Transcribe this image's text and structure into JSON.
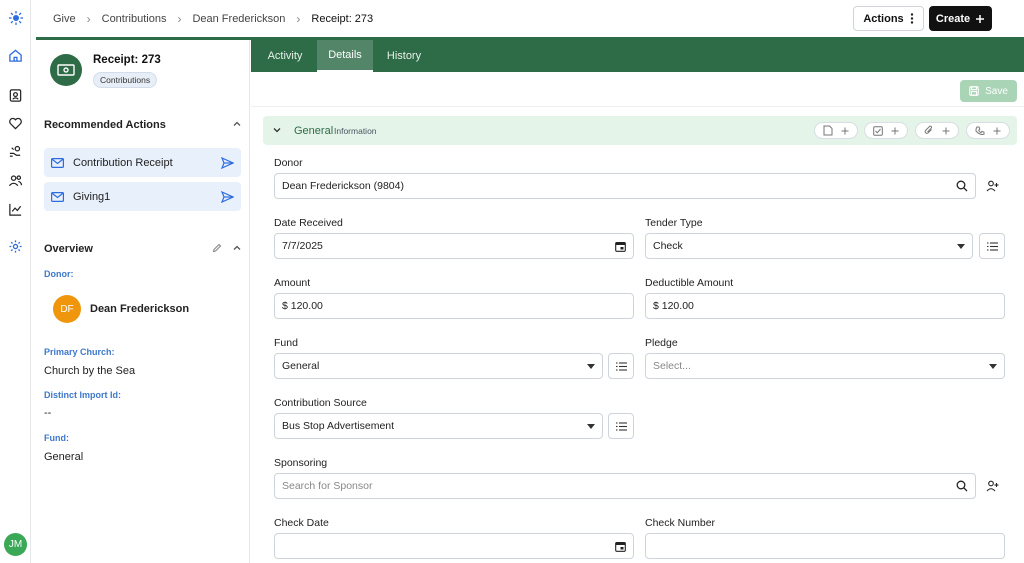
{
  "rail": {
    "icons": [
      "app-logo-icon",
      "home-icon",
      "contacts-icon",
      "heart-icon",
      "give-icon",
      "people-icon",
      "chart-icon",
      "settings-icon"
    ],
    "user_initials": "JM"
  },
  "breadcrumb": {
    "items": [
      "Give",
      "Contributions",
      "Dean Frederickson"
    ],
    "current": "Receipt: 273"
  },
  "header": {
    "actions_label": "Actions",
    "create_label": "Create"
  },
  "left": {
    "title": "Receipt: 273",
    "tag": "Contributions",
    "recommended_title": "Recommended Actions",
    "actions": [
      {
        "label": "Contribution Receipt"
      },
      {
        "label": "Giving1"
      }
    ],
    "overview_title": "Overview",
    "donor_label": "Donor:",
    "donor_initials": "DF",
    "donor_name": "Dean Frederickson",
    "church_label": "Primary Church:",
    "church_value": "Church by the Sea",
    "import_label": "Distinct Import Id:",
    "import_value": "--",
    "fund_label": "Fund:",
    "fund_value": "General"
  },
  "tabs": [
    {
      "label": "Activity"
    },
    {
      "label": "Details"
    },
    {
      "label": "History"
    }
  ],
  "active_tab": "Details",
  "save_label": "Save",
  "section": {
    "title": "General",
    "subtitle": "Information"
  },
  "form": {
    "donor": {
      "label": "Donor",
      "value": "Dean Frederickson (9804)"
    },
    "date_received": {
      "label": "Date Received",
      "value": "7/7/2025"
    },
    "tender_type": {
      "label": "Tender Type",
      "value": "Check"
    },
    "amount": {
      "label": "Amount",
      "value": "$ 120.00"
    },
    "deductible_amount": {
      "label": "Deductible Amount",
      "value": "$ 120.00"
    },
    "fund": {
      "label": "Fund",
      "value": "General"
    },
    "pledge": {
      "label": "Pledge",
      "placeholder": "Select..."
    },
    "contribution_source": {
      "label": "Contribution Source",
      "value": "Bus Stop Advertisement"
    },
    "sponsoring": {
      "label": "Sponsoring",
      "placeholder": "Search for Sponsor"
    },
    "check_date": {
      "label": "Check Date",
      "value": ""
    },
    "check_number": {
      "label": "Check Number",
      "value": ""
    }
  },
  "colors": {
    "brand_green": "#2e6b47",
    "accent_blue": "#3e78c9",
    "save_disabled": "#a9d4b6",
    "section_bg": "#e4f4e8",
    "donor_avatar": "#f0960c",
    "user_avatar": "#3aa856"
  }
}
